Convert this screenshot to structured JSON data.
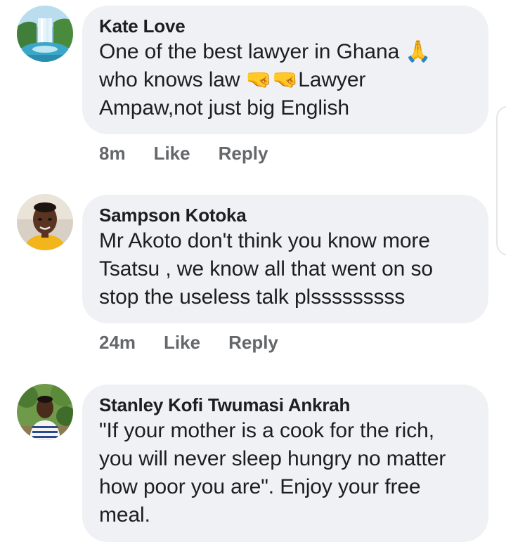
{
  "comments": [
    {
      "author": "Kate Love",
      "text_line1": "One of the best lawyer in Ghana 🙏",
      "text_line2": "who knows law 🤜🤜Lawyer",
      "text_line3": "Ampaw,not just big English",
      "time": "8m",
      "like_label": "Like",
      "reply_label": "Reply",
      "avatar": "waterfall-landscape-avatar"
    },
    {
      "author": "Sampson Kotoka",
      "text_line1": "Mr Akoto don't think you know more",
      "text_line2": "Tsatsu , we know all that went on so",
      "text_line3": "stop the useless talk plsssssssss",
      "time": "24m",
      "like_label": "Like",
      "reply_label": "Reply",
      "avatar": "man-portrait-avatar"
    },
    {
      "author": "Stanley Kofi Twumasi Ankrah",
      "text_line1": "\"If your mother is a cook for the rich,",
      "text_line2": "you will never sleep hungry no matter",
      "text_line3": "how poor you are\". Enjoy your free",
      "text_line4": "meal.",
      "avatar": "man-outdoor-avatar"
    }
  ],
  "colors": {
    "bubble": "#eff1f5",
    "text": "#1c1e21",
    "meta": "#65676b"
  }
}
